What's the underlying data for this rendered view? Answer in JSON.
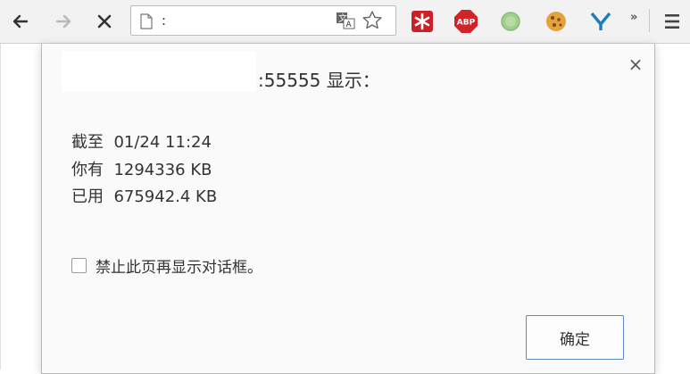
{
  "browser": {
    "address": {
      "partial_text": ":",
      "icons": [
        "page-icon",
        "translate-icon",
        "bookmark-star-icon"
      ]
    },
    "nav": [
      "back-arrow-icon",
      "forward-arrow-icon",
      "stop-icon"
    ],
    "extensions": [
      {
        "icon": "lastpass-icon",
        "color": "#cc2029"
      },
      {
        "icon": "adblock-plus-icon",
        "label": "ABP",
        "color": "#d0232a"
      },
      {
        "icon": "circle-extension-icon",
        "color": "#9fcf8a"
      },
      {
        "icon": "cookie-icon",
        "color": "#e3a23b"
      },
      {
        "icon": "y-extension-icon",
        "color": "#1d7fb8"
      }
    ],
    "overflow": "»",
    "menu": "menu-icon"
  },
  "dialog": {
    "title": ":55555 显示：",
    "close_symbol": "×",
    "lines": [
      {
        "label": "截至",
        "value": "01/24 11:24"
      },
      {
        "label": "你有",
        "value": "1294336 KB"
      },
      {
        "label": "已用",
        "value": "675942.4 KB"
      }
    ],
    "suppress_label": "禁止此页再显示对话框。",
    "ok_label": "确定"
  }
}
